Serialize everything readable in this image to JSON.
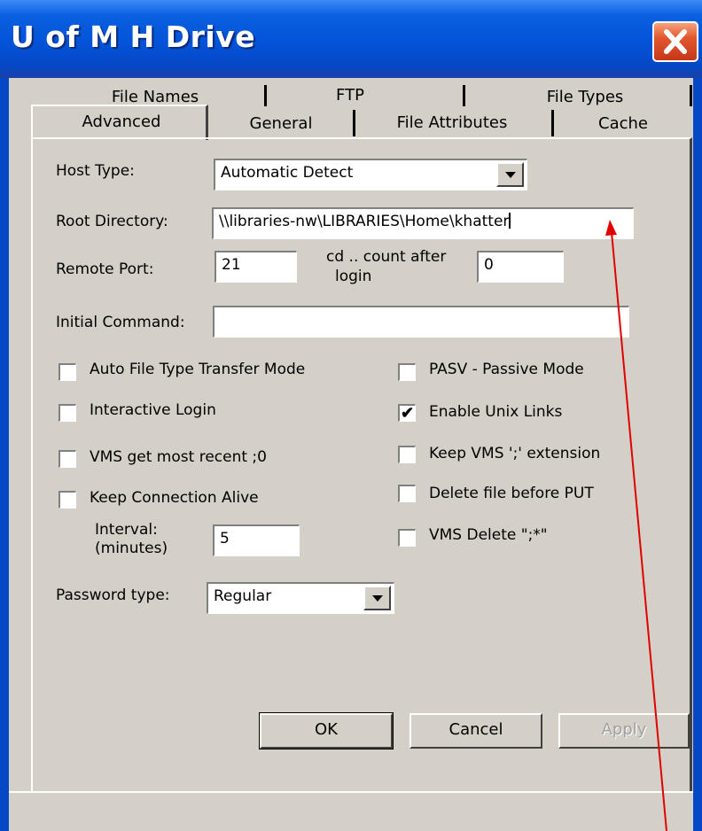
{
  "window": {
    "title": "U of M H Drive",
    "close_icon": "close-icon",
    "colors": {
      "titlebar": "#0453d8",
      "dialog": "#d4d0c8",
      "close": "#e2572d",
      "annotation_arrow": "#e00000"
    }
  },
  "tabs": {
    "row1": [
      "File Names",
      "FTP",
      "File Types"
    ],
    "row2": [
      "Advanced",
      "General",
      "File Attributes",
      "Cache"
    ],
    "active": "Advanced"
  },
  "form": {
    "host_type_label": "Host Type:",
    "host_type_value": "Automatic Detect",
    "root_dir_label": "Root Directory:",
    "root_dir_value": "\\\\libraries-nw\\LIBRARIES\\Home\\khatter",
    "remote_port_label": "Remote Port:",
    "remote_port_value": "21",
    "cd_count_label_1": "cd ..  count after",
    "cd_count_label_2": "login",
    "cd_count_value": "0",
    "initial_command_label": "Initial Command:",
    "initial_command_value": "",
    "interval_label_1": "Interval:",
    "interval_label_2": "(minutes)",
    "interval_value": "5",
    "password_type_label": "Password type:",
    "password_type_value": "Regular"
  },
  "checkboxes": {
    "auto_file_type": {
      "label": "Auto File Type Transfer Mode",
      "checked": false
    },
    "interactive_login": {
      "label": "Interactive Login",
      "checked": false
    },
    "vms_recent": {
      "label": "VMS get most recent ;0",
      "checked": false
    },
    "keep_alive": {
      "label": "Keep Connection Alive",
      "checked": false
    },
    "pasv": {
      "label": "PASV - Passive Mode",
      "checked": false
    },
    "unix_links": {
      "label": "Enable Unix Links",
      "checked": true
    },
    "keep_vms_ext": {
      "label": "Keep VMS ';' extension",
      "checked": false
    },
    "delete_before_put": {
      "label": "Delete file before PUT",
      "checked": false
    },
    "vms_delete": {
      "label": "VMS Delete \";*\"",
      "checked": false
    }
  },
  "buttons": {
    "ok": "OK",
    "cancel": "Cancel",
    "apply": "Apply"
  }
}
